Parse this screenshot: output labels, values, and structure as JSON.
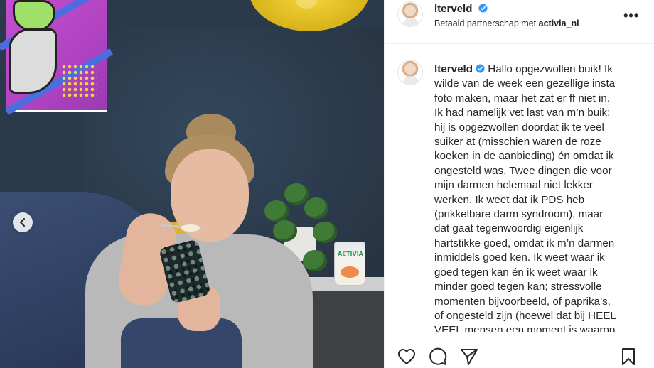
{
  "post": {
    "username": "lterveld",
    "partnership_prefix": "Betaald partnerschap met ",
    "partner": "activia_nl",
    "more_label": "•••"
  },
  "caption": {
    "username": "lterveld",
    "first_line": " Hallo opgezwollen buik! Ik",
    "lines": [
      "wilde van de week een gezellige insta",
      "foto maken, maar het zat er ff niet in.",
      "Ik had namelijk vet last van m’n buik;",
      "hij is opgezwollen doordat ik te veel",
      "suiker at (misschien waren de roze",
      "koeken in de aanbieding) én omdat ik",
      "ongesteld was. Twee dingen die voor",
      "mijn darmen helemaal niet lekker",
      "werken. Ik weet dat ik PDS heb",
      "(prikkelbare darm syndroom), maar",
      "dat gaat tegenwoordig eigenlijk",
      "hartstikke goed, omdat ik m’n darmen",
      "inmiddels goed ken. Ik weet waar ik",
      "goed tegen kan én ik weet waar ik",
      "minder goed tegen kan; stressvolle",
      "momenten bijvoorbeeld, of paprika’s,",
      "of ongesteld zijn (hoewel dat bij HEEL",
      "VEEL mensen een moment is waarop"
    ]
  },
  "photo": {
    "cup_brand": "ACTIVIA"
  },
  "icons": {
    "verified": "verified-badge-icon",
    "prev": "chevron-left-icon",
    "like": "heart-icon",
    "comment": "comment-icon",
    "share": "paper-plane-icon",
    "save": "bookmark-icon"
  },
  "colors": {
    "verified_blue": "#3897f0",
    "text": "#262626",
    "wall": "#2b3a4b"
  }
}
